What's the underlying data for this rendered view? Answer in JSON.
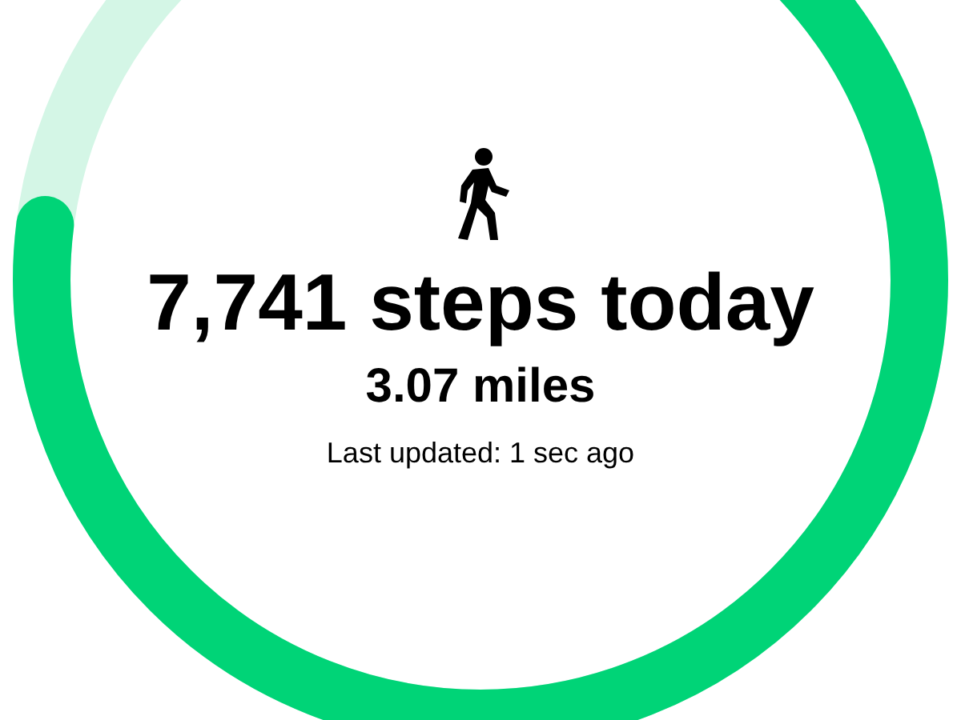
{
  "steps_label": "7,741 steps today",
  "distance": "3.07 miles",
  "last_updated": "Last updated: 1 sec ago"
}
